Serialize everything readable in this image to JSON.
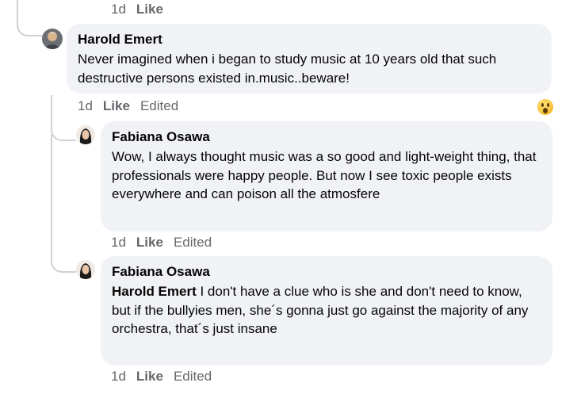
{
  "top_meta": {
    "time": "1d",
    "like": "Like"
  },
  "comments": [
    {
      "author": "Harold Emert",
      "text": "Never imagined when i began to study music at 10 years old that such destructive persons existed in.music..beware!",
      "time": "1d",
      "like": "Like",
      "edited": "Edited",
      "reaction": "wow-emoji"
    },
    {
      "author": "Fabiana Osawa",
      "text": "Wow, I always thought music was a so good and light-weight thing, that professionals were happy people. But now I see toxic people exists everywhere and can poison all the atmosfere",
      "time": "1d",
      "like": "Like",
      "edited": "Edited"
    },
    {
      "author": "Fabiana Osawa",
      "mention": "Harold Emert",
      "text": " I don't have a clue who is she and don't need to know, but if the bullyies men, she´s gonna just go against the majority of any orchestra, that´s just insane",
      "time": "1d",
      "like": "Like",
      "edited": "Edited"
    }
  ]
}
